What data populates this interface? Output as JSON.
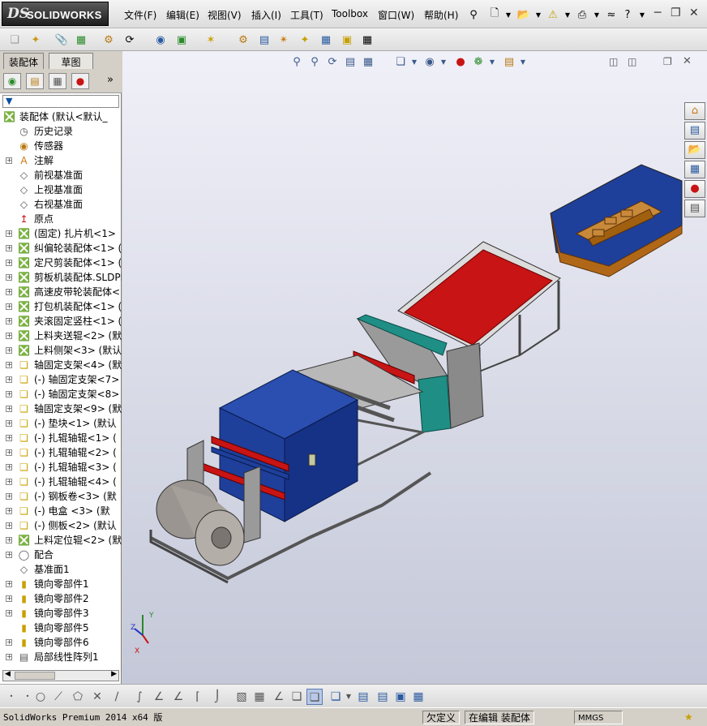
{
  "app": {
    "logo_mark": "DS",
    "logo_name": "SOLIDWORKS"
  },
  "menu": [
    "文件(F)",
    "编辑(E)",
    "视图(V)",
    "插入(I)",
    "工具(T)",
    "Toolbox",
    "窗口(W)",
    "帮助(H)"
  ],
  "panel_tabs": [
    "装配体",
    "草图"
  ],
  "tree": [
    {
      "label": "装配体   (默认<默认_",
      "icon": "assembly-icon",
      "expander": false,
      "level": 0
    },
    {
      "label": "历史记录",
      "icon": "history-icon",
      "expander": false,
      "level": 1
    },
    {
      "label": "传感器",
      "icon": "sensor-icon",
      "expander": false,
      "level": 1
    },
    {
      "label": "注解",
      "icon": "annotation-icon",
      "expander": true,
      "level": 1
    },
    {
      "label": "前视基准面",
      "icon": "plane-icon",
      "expander": false,
      "level": 1
    },
    {
      "label": "上视基准面",
      "icon": "plane-icon",
      "expander": false,
      "level": 1
    },
    {
      "label": "右视基准面",
      "icon": "plane-icon",
      "expander": false,
      "level": 1
    },
    {
      "label": "原点",
      "icon": "origin-icon",
      "expander": false,
      "level": 1
    },
    {
      "label": "(固定) 扎片机<1>",
      "icon": "subassembly-icon",
      "expander": true,
      "level": 1
    },
    {
      "label": "纠偏轮装配体<1>  (",
      "icon": "subassembly-icon",
      "expander": true,
      "level": 1
    },
    {
      "label": "定尺剪装配体<1>  (",
      "icon": "subassembly-icon",
      "expander": true,
      "level": 1
    },
    {
      "label": "剪板机装配体.SLDPR",
      "icon": "subassembly-icon",
      "expander": true,
      "level": 1
    },
    {
      "label": "高速皮带轮装配体<",
      "icon": "subassembly-icon",
      "expander": true,
      "level": 1
    },
    {
      "label": "打包机装配体<1>  (",
      "icon": "subassembly-icon",
      "expander": true,
      "level": 1
    },
    {
      "label": "夹滚固定竖柱<1>  (",
      "icon": "subassembly-icon",
      "expander": true,
      "level": 1
    },
    {
      "label": "上料夹送辊<2>  (默",
      "icon": "subassembly-icon",
      "expander": true,
      "level": 1
    },
    {
      "label": "上料侧架<3>  (默认",
      "icon": "subassembly-icon",
      "expander": true,
      "level": 1
    },
    {
      "label": "轴固定支架<4>  (默",
      "icon": "part-icon",
      "expander": true,
      "level": 1
    },
    {
      "label": "(-) 轴固定支架<7>",
      "icon": "part-icon",
      "expander": true,
      "level": 1
    },
    {
      "label": "(-) 轴固定支架<8>",
      "icon": "part-icon",
      "expander": true,
      "level": 1
    },
    {
      "label": "轴固定支架<9>  (默",
      "icon": "part-icon",
      "expander": true,
      "level": 1
    },
    {
      "label": "(-) 垫块<1>  (默认",
      "icon": "part-icon",
      "expander": true,
      "level": 1
    },
    {
      "label": "(-) 扎辊轴辊<1>  (",
      "icon": "part-icon",
      "expander": true,
      "level": 1
    },
    {
      "label": "(-) 扎辊轴辊<2>  (",
      "icon": "part-icon",
      "expander": true,
      "level": 1
    },
    {
      "label": "(-) 扎辊轴辊<3>  (",
      "icon": "part-icon",
      "expander": true,
      "level": 1
    },
    {
      "label": "(-) 扎辊轴辊<4>  (",
      "icon": "part-icon",
      "expander": true,
      "level": 1
    },
    {
      "label": "(-) 钢板卷<3>  (默",
      "icon": "part-icon",
      "expander": true,
      "level": 1
    },
    {
      "label": "(-) 电盒  <3>  (默",
      "icon": "part-icon",
      "expander": true,
      "level": 1
    },
    {
      "label": "(-) 侧板<2>  (默认",
      "icon": "part-icon",
      "expander": true,
      "level": 1
    },
    {
      "label": "上料定位辊<2>  (默",
      "icon": "subassembly-icon",
      "expander": true,
      "level": 1
    },
    {
      "label": "配合",
      "icon": "mate-icon",
      "expander": true,
      "level": 1
    },
    {
      "label": "基准面1",
      "icon": "plane-icon",
      "expander": false,
      "level": 1
    },
    {
      "label": "镜向零部件1",
      "icon": "mirror-icon",
      "expander": true,
      "level": 1
    },
    {
      "label": "镜向零部件2",
      "icon": "mirror-icon",
      "expander": true,
      "level": 1
    },
    {
      "label": "镜向零部件3",
      "icon": "mirror-icon",
      "expander": true,
      "level": 1
    },
    {
      "label": "镜向零部件5",
      "icon": "mirror-icon",
      "expander": false,
      "level": 1
    },
    {
      "label": "镜向零部件6",
      "icon": "mirror-icon",
      "expander": true,
      "level": 1
    },
    {
      "label": "局部线性阵列1",
      "icon": "pattern-icon",
      "expander": true,
      "level": 1
    }
  ],
  "status": {
    "product": "SolidWorks Premium 2014 x64 版",
    "definition": "欠定义",
    "editing": "在编辑 装配体",
    "units": "MMGS"
  },
  "colors": {
    "guard_blue": "#1e3f9a",
    "conveyor_red": "#c81414",
    "steel": "#9a9a9a",
    "teal": "#1f8f86",
    "wood": "#b06818"
  }
}
